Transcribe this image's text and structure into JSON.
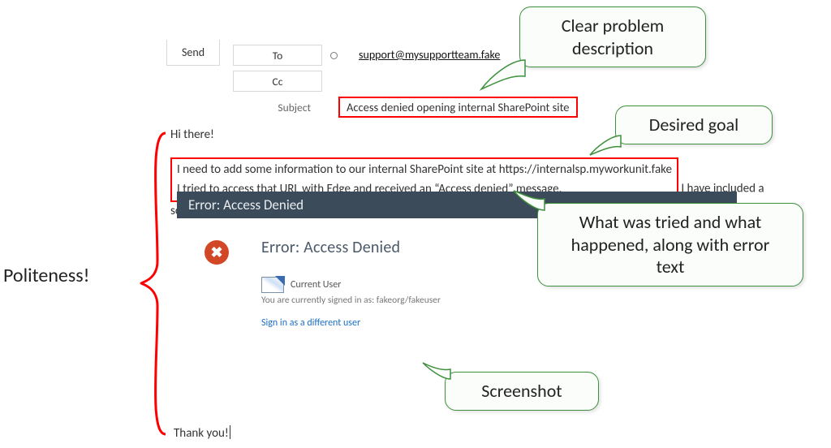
{
  "compose": {
    "send": "Send",
    "to_label": "To",
    "cc_label": "Cc",
    "subject_label": "Subject",
    "recipient": "support@mysupportteam.fake",
    "subject_value": "Access denied opening internal SharePoint site"
  },
  "body": {
    "greeting": "Hi there!",
    "line1": "I need to add some information to our internal SharePoint site at https://internalsp.myworkunit.fake",
    "line2a": "I tried to access that URL with Edge and received an “Access denied” message.",
    "line2b": " I have included a screenshot:",
    "thanks": "Thank you!"
  },
  "screenshot": {
    "title": "Error: Access Denied",
    "heading": "Error: Access Denied",
    "x_glyph": "✖",
    "current_user_label": "Current User",
    "signed_in": "You are currently signed in as: fakeorg/fakeuser",
    "signin_link": "Sign in as a different user"
  },
  "annotations": {
    "politeness": "Politeness!",
    "clear_problem": "Clear problem description",
    "desired_goal": "Desired goal",
    "what_tried": "What was tried and what happened, along with error text",
    "screenshot": "Screenshot"
  }
}
